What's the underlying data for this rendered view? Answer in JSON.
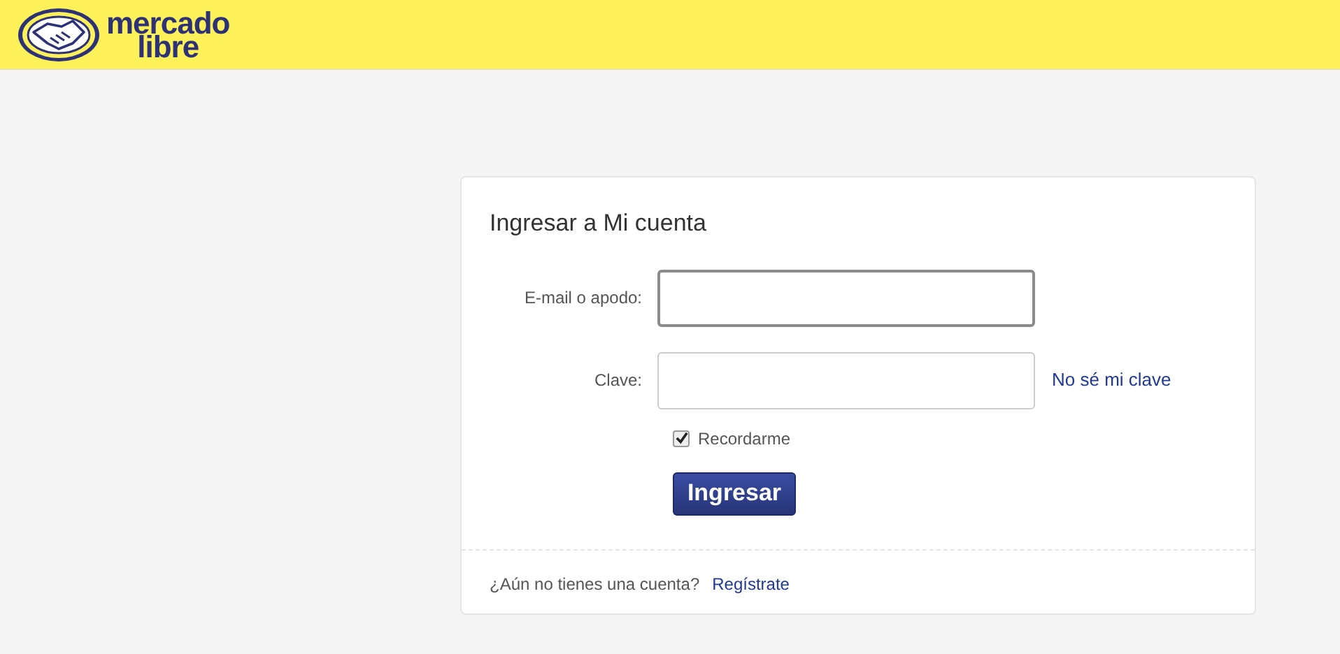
{
  "header": {
    "logo_lines": [
      "mercado",
      "libre"
    ]
  },
  "login": {
    "title": "Ingresar a Mi cuenta",
    "fields": [
      {
        "label": "E-mail o apodo:",
        "focused": true
      },
      {
        "label": "Clave:",
        "focused": false,
        "link": "No sé mi clave"
      }
    ],
    "remember": {
      "label": "Recordarme",
      "checked": true
    },
    "submit": "Ingresar",
    "footer": {
      "text": "¿Aún no tienes una cuenta?",
      "link": "Regístrate"
    }
  }
}
